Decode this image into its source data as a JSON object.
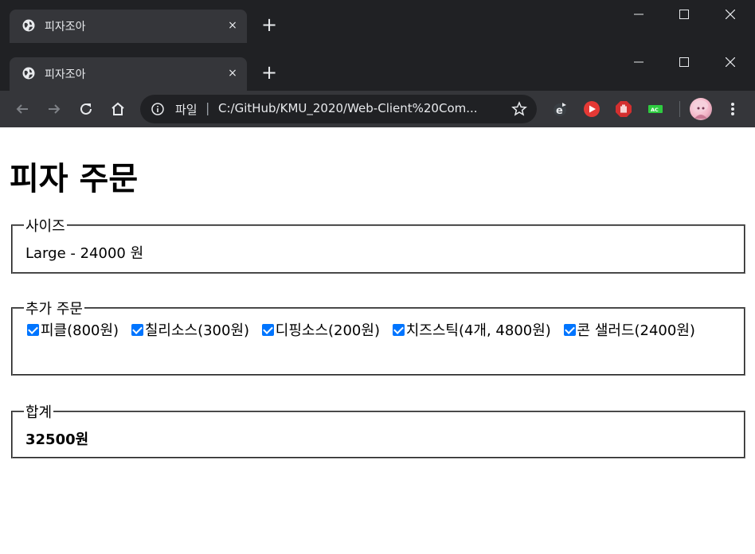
{
  "browser": {
    "tab_title": "피자조아",
    "tab_title_back": "피자조아",
    "address_scheme": "파일",
    "address_separator": "|",
    "url": "C:/GitHub/KMU_2020/Web-Client%20Com...",
    "close_tab_glyph": "×",
    "new_tab_glyph": "+",
    "icons": [
      "globe-icon",
      "back-icon",
      "forward-icon",
      "reload-icon",
      "home-icon",
      "info-icon",
      "star-icon",
      "menu-icon"
    ],
    "extensions": [
      "edge-extension-icon",
      "youtube-extension-icon",
      "adblock-extension-icon",
      "ac-extension-icon"
    ],
    "ac_badge": "AC"
  },
  "page": {
    "heading": "피자 주문",
    "size": {
      "legend": "사이즈",
      "value": "Large - 24000 원"
    },
    "extras": {
      "legend": "추가 주문",
      "options": [
        {
          "label": "피클(800원)",
          "checked": true
        },
        {
          "label": "칠리소스(300원)",
          "checked": true
        },
        {
          "label": "디핑소스(200원)",
          "checked": true
        },
        {
          "label": "치즈스틱(4개, 4800원)",
          "checked": true
        },
        {
          "label": "콘 샐러드(2400원)",
          "checked": true
        }
      ]
    },
    "total": {
      "legend": "합계",
      "value": "32500원"
    }
  },
  "colors": {
    "titlebar": "#202124",
    "toolbar": "#35363a",
    "checkbox": "#0075ff"
  }
}
